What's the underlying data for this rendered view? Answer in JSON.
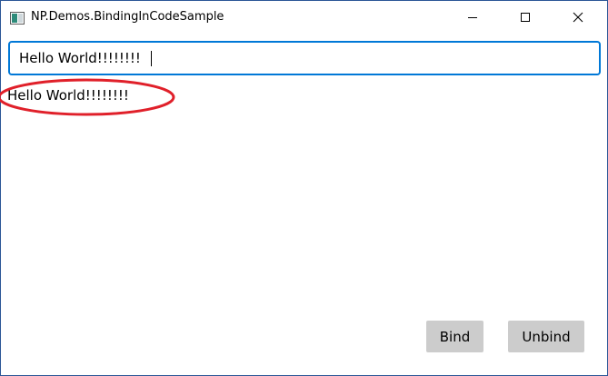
{
  "window": {
    "title": "NP.Demos.BindingInCodeSample",
    "app_icon": "window-app-icon",
    "controls": [
      "minimize-icon",
      "maximize-icon",
      "close-icon"
    ]
  },
  "textbox": {
    "value": "Hello World!!!!!!!!"
  },
  "bound_text": {
    "text": "Hello World!!!!!!!!"
  },
  "annotation": {
    "shape": "ellipse",
    "color": "#e0202a"
  },
  "buttons": {
    "bind_label": "Bind",
    "unbind_label": "Unbind"
  },
  "colors": {
    "accent": "#0078d7",
    "window_border": "#2b5797",
    "button_bg": "#cccccc"
  }
}
